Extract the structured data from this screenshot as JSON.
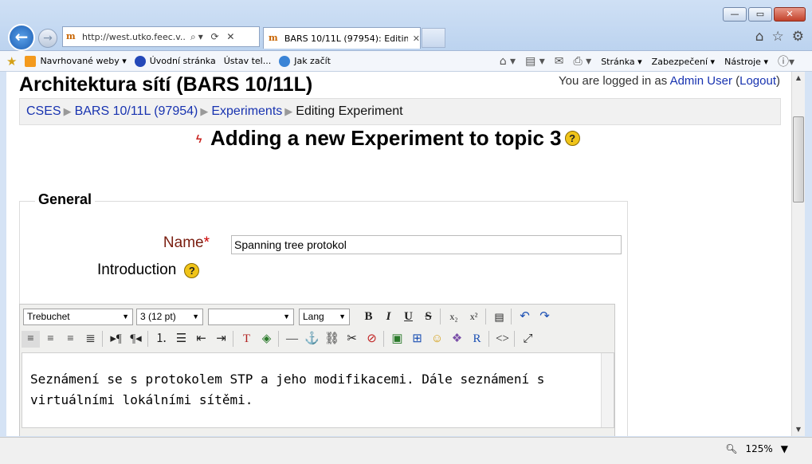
{
  "browser": {
    "address": "http://west.utko.feec.v...",
    "tab_title": "BARS 10/11L (97954): Editin...",
    "favicon_letter": "m",
    "zoom": "125%"
  },
  "commandbar": {
    "bookmarks": [
      {
        "label": "Navrhované weby ▾",
        "icon_color": "#f39a1e"
      },
      {
        "label": "Úvodní stránka",
        "icon_color": "#2448b8"
      },
      {
        "label": "Ústav tel...",
        "icon_color": "transparent"
      },
      {
        "label": "Jak začít",
        "icon_color": "#3a84d6"
      }
    ],
    "page_menu": "Stránka ▾",
    "security_menu": "Zabezpečení ▾",
    "tools_menu": "Nástroje ▾"
  },
  "page": {
    "title": "Architektura sítí (BARS 10/11L)",
    "login_prefix": "You are logged in as ",
    "login_user": "Admin User",
    "login_open": " (",
    "logout": "Logout",
    "login_close": ")",
    "breadcrumb": {
      "c1": "CSES",
      "c2": "BARS 10/11L (97954)",
      "c3": "Experiments",
      "current": "Editing Experiment",
      "sep": "▶"
    },
    "heading": "Adding a new Experiment to topic 3",
    "help_glyph": "?"
  },
  "form": {
    "legend": "General",
    "name_label": "Name",
    "required_mark": "*",
    "name_value": "Spanning tree protokol",
    "intro_label": "Introduction"
  },
  "editor": {
    "font": "Trebuchet",
    "size": "3 (12 pt)",
    "style": "",
    "lang": "Lang",
    "content": "Seznámení se s protokolem STP a jeho modifikacemi. Dále seznámení s virtuálními lokálními sítěmi."
  }
}
